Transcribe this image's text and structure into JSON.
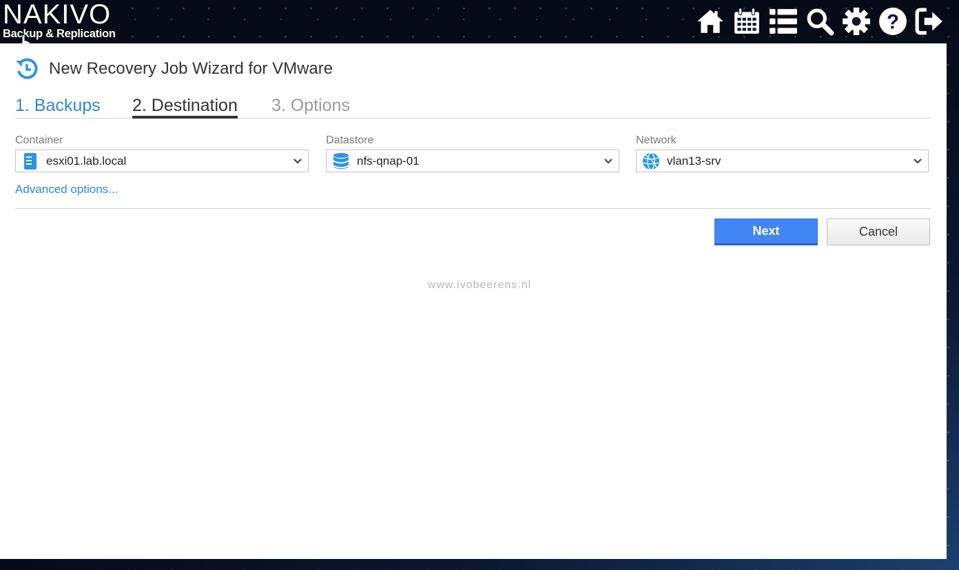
{
  "header": {
    "logo_main": "NAKIVO",
    "logo_sub": "Backup & Replication",
    "icons": [
      "home-icon",
      "calendar-icon",
      "list-icon",
      "search-icon",
      "gear-icon",
      "help-icon",
      "logout-icon"
    ]
  },
  "wizard": {
    "title": "New Recovery Job Wizard for VMware",
    "steps": [
      {
        "label": "1. Backups",
        "state": "done"
      },
      {
        "label": "2. Destination",
        "state": "active"
      },
      {
        "label": "3. Options",
        "state": "pending"
      }
    ]
  },
  "fields": {
    "container": {
      "label": "Container",
      "value": "esxi01.lab.local",
      "icon": "server-icon"
    },
    "datastore": {
      "label": "Datastore",
      "value": "nfs-qnap-01",
      "icon": "database-icon"
    },
    "network": {
      "label": "Network",
      "value": "vlan13-srv",
      "icon": "globe-icon"
    }
  },
  "advanced_link": "Advanced options...",
  "buttons": {
    "next": "Next",
    "cancel": "Cancel"
  },
  "watermark": "www.ivobeerens.nl",
  "colors": {
    "accent": "#4285f4",
    "link": "#2f86d8",
    "icon_blue": "#2b95e9"
  }
}
